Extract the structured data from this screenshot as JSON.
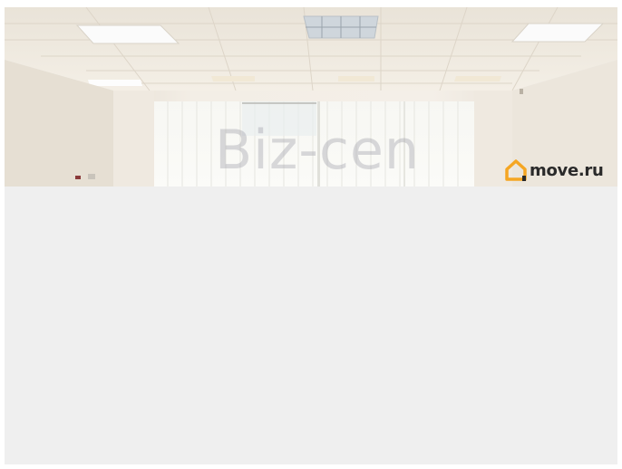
{
  "listing_photo": {
    "watermark_text": "Biz-cen",
    "brand": {
      "name": "move.ru",
      "icon": "house-logo-icon",
      "icon_color": "#f5a623"
    }
  },
  "colors": {
    "background": "#efefef",
    "ceiling": "#f3efe6",
    "wall": "#f7f3ec"
  }
}
